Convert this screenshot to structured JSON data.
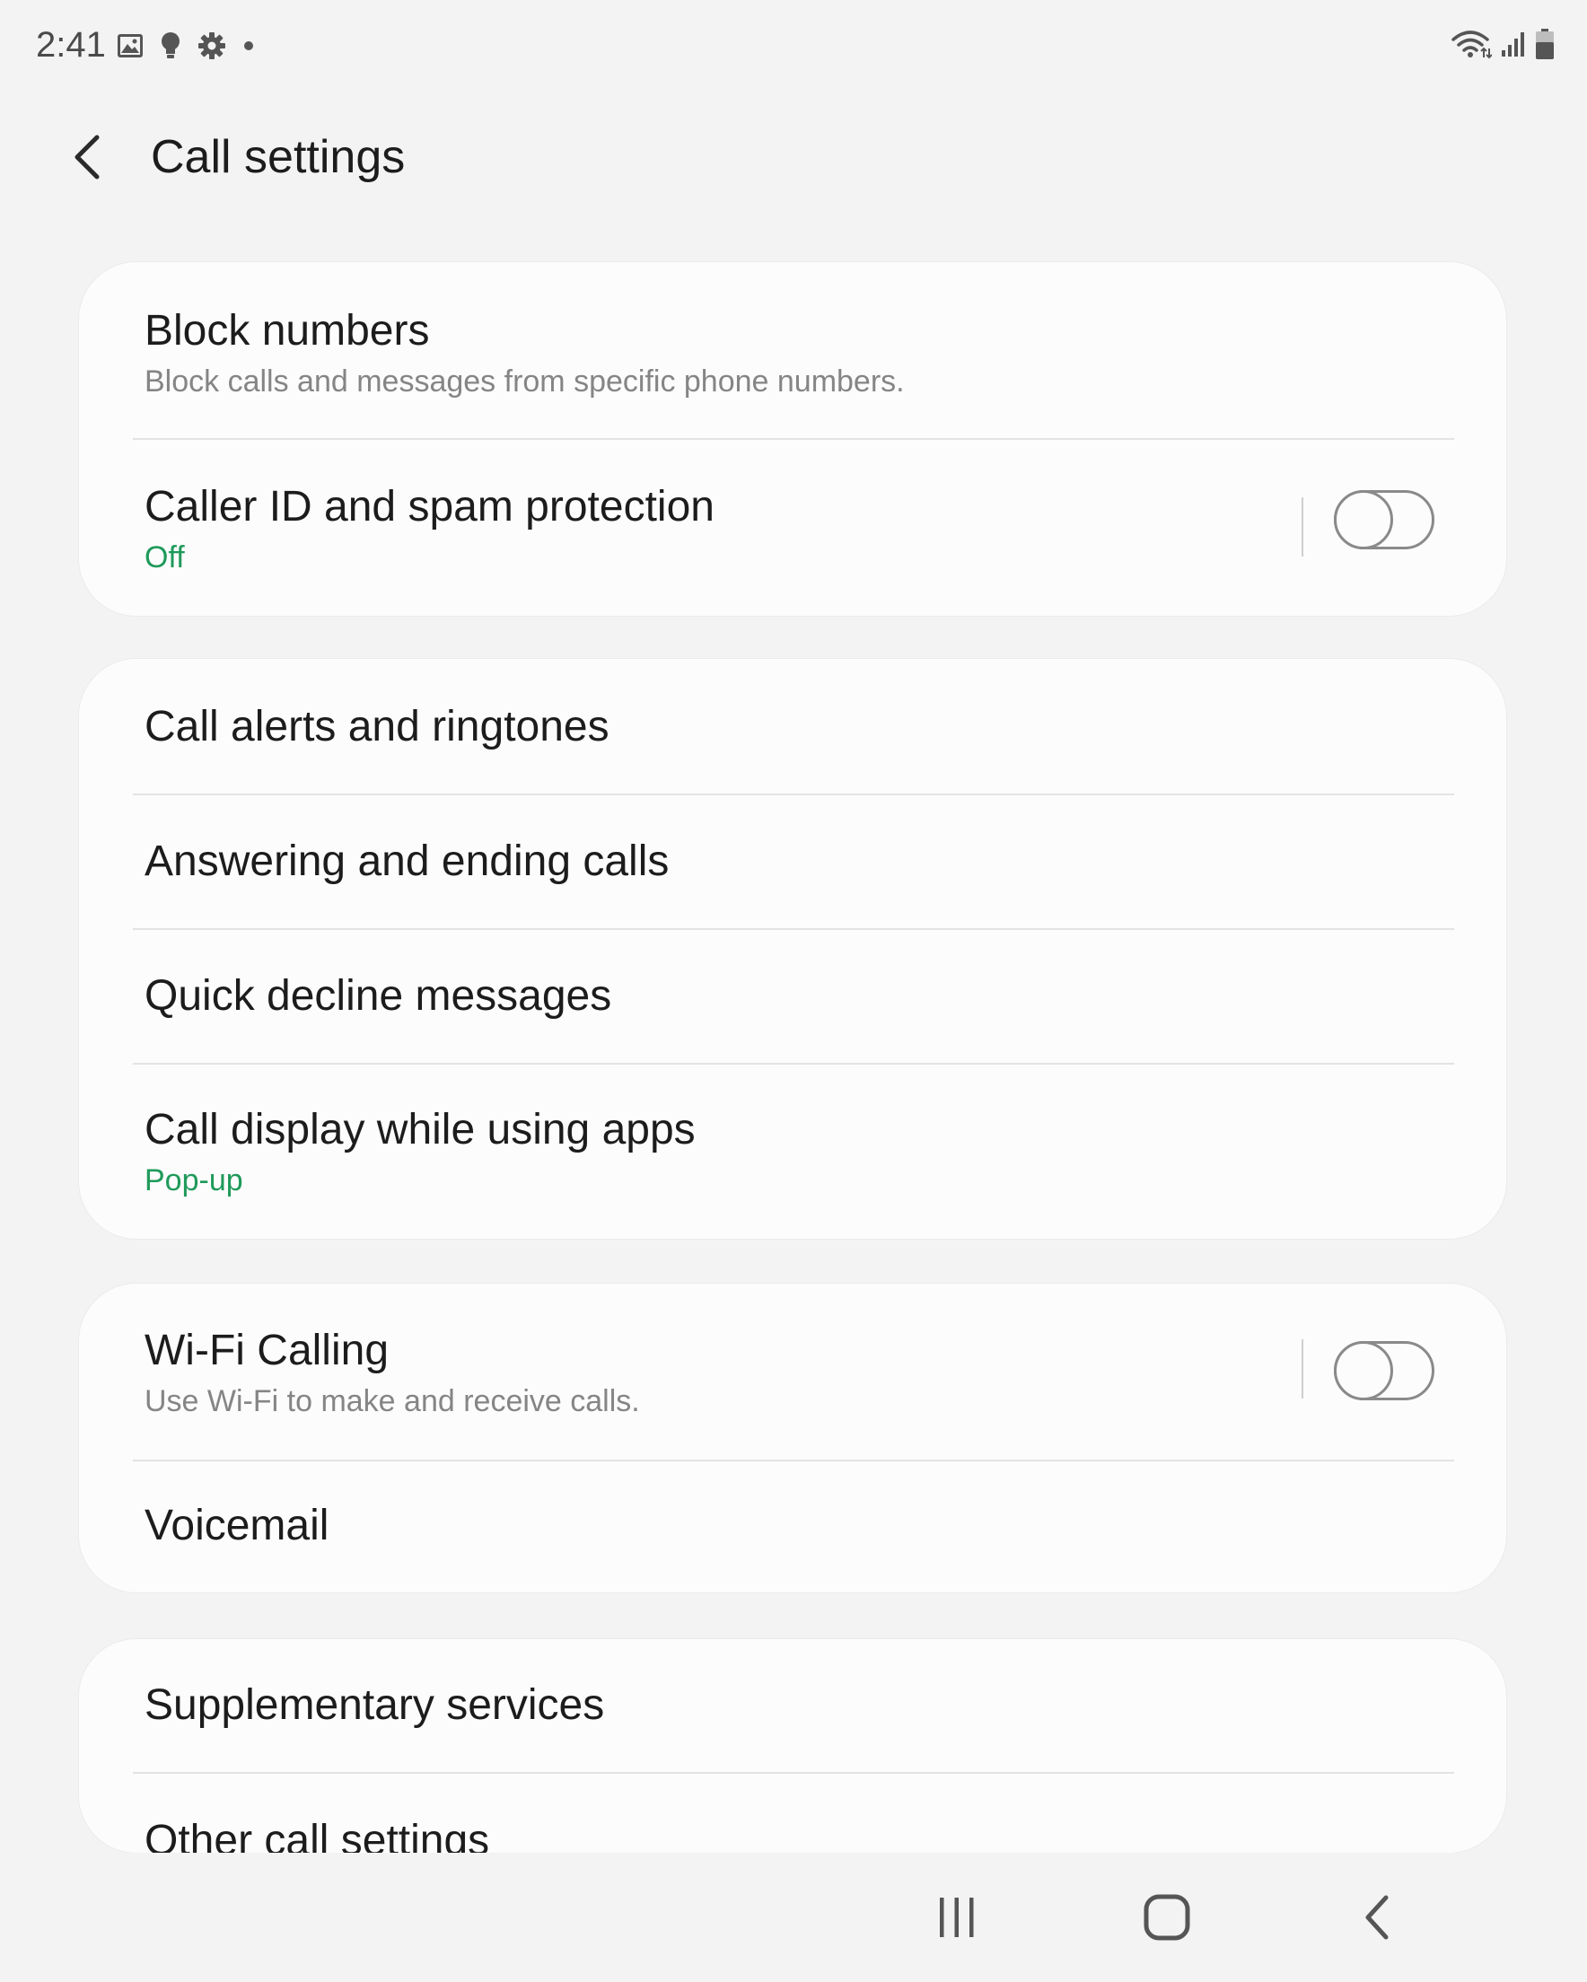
{
  "status_bar": {
    "time": "2:41",
    "left_icons": [
      "gallery-icon",
      "lightbulb-icon",
      "gear-icon",
      "dot-icon"
    ],
    "right_icons": [
      "wifi-icon",
      "signal-icon",
      "battery-icon"
    ]
  },
  "header": {
    "back_icon": "chevron-left-icon",
    "title": "Call settings"
  },
  "groups": [
    {
      "items": [
        {
          "title": "Block numbers",
          "subtitle": "Block calls and messages from specific phone numbers."
        },
        {
          "title": "Caller ID and spam protection",
          "subtitle": "Off",
          "toggle": false
        }
      ]
    },
    {
      "items": [
        {
          "title": "Call alerts and ringtones"
        },
        {
          "title": "Answering and ending calls"
        },
        {
          "title": "Quick decline messages"
        },
        {
          "title": "Call display while using apps",
          "subtitle": "Pop-up"
        }
      ]
    },
    {
      "items": [
        {
          "title": "Wi-Fi Calling",
          "subtitle": "Use Wi-Fi to make and receive calls.",
          "toggle": false
        },
        {
          "title": "Voicemail"
        }
      ]
    },
    {
      "items": [
        {
          "title": "Supplementary services"
        },
        {
          "title": "Other call settings"
        }
      ]
    }
  ],
  "navbar": {
    "icons": [
      "recent-apps-icon",
      "home-icon",
      "back-icon"
    ]
  },
  "colors": {
    "accent": "#1f9a5a",
    "background": "#f3f3f3",
    "card": "#fcfcfc"
  }
}
